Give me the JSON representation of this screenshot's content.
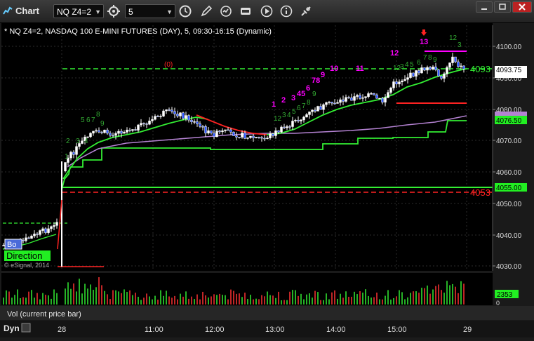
{
  "window": {
    "app_title": "Chart",
    "symbol_value": "NQ Z4=2",
    "interval_value": "5"
  },
  "chart_header": "* NQ Z4=2, NASDAQ 100 E-MINI FUTURES (DAY), 5, 09:30-16:15 (Dynamic)",
  "watermark": "© eSignal, 2014",
  "direction_label": "Direction",
  "bo_label": "Bo",
  "price_axis": {
    "ticks": [
      "4100.00",
      "4090.00",
      "4080.00",
      "4070.00",
      "4060.00",
      "4050.00",
      "4040.00",
      "4030.00"
    ]
  },
  "time_axis": {
    "ticks": [
      "28",
      "11:00",
      "12:00",
      "13:00",
      "14:00",
      "15:00",
      "29"
    ]
  },
  "price_tags": [
    {
      "text": "4093.75",
      "bg": "#ffffff",
      "fg": "#000000"
    },
    {
      "text": "4092.25",
      "bg": "#ffffff",
      "fg": "#000000"
    },
    {
      "text": "4076.50",
      "bg": "#22ee22",
      "fg": "#000000"
    },
    {
      "text": "4077.25",
      "bg": "#b482d2",
      "fg": "#000000"
    },
    {
      "text": "4055.00",
      "bg": "#22ee22",
      "fg": "#000000"
    }
  ],
  "line_labels": {
    "upper": "4093",
    "lower": "4053",
    "marker": "(0)"
  },
  "volume_panel": {
    "title": "Vol (current price bar)",
    "tag": "2353",
    "zero": "0"
  },
  "bottom_bar": {
    "label": "Dyn"
  },
  "colors": {
    "bg": "#000000",
    "green": "#33ee33",
    "red": "#ff2222",
    "magenta": "#ff00ff",
    "purple": "#b482d2",
    "count_green": "#33aa33"
  },
  "chart_data": {
    "type": "candlestick",
    "ylim": [
      4028,
      4104
    ],
    "levels": [
      {
        "name": "upper-dashed",
        "value": 4093,
        "style": "dashed",
        "color": "#33ee33"
      },
      {
        "name": "lower-dashed",
        "value": 4053,
        "style": "dashed",
        "color": "#ff2222"
      },
      {
        "name": "lower-solid",
        "value": 4055,
        "style": "solid",
        "color": "#33ee33"
      }
    ],
    "tdcounts_setup": [
      "1",
      "2",
      "3",
      "4",
      "5",
      "6",
      "7",
      "8",
      "9",
      "12",
      "13"
    ],
    "tdcounts_other": [
      "1",
      "2",
      "3",
      "4",
      "5",
      "6",
      "7",
      "8",
      "9",
      "12"
    ]
  }
}
